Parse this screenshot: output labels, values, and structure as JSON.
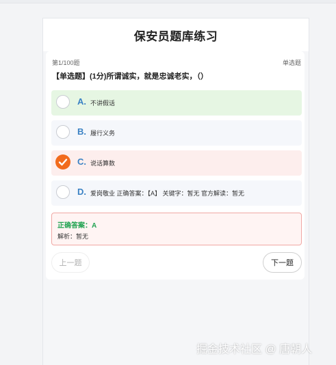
{
  "header": {
    "title": "保安员题库练习"
  },
  "question": {
    "progress": "第1/100题",
    "type_label": "单选题",
    "text": "【单选题】(1分)所谓诚实，就是忠诚老实，（）"
  },
  "options": [
    {
      "letter": "A.",
      "text": "不讲假话",
      "state": "correct"
    },
    {
      "letter": "B.",
      "text": "履行义务",
      "state": "normal"
    },
    {
      "letter": "C.",
      "text": "说话算数",
      "state": "selected-wrong"
    },
    {
      "letter": "D.",
      "text": "爱岗敬业 正确答案：【A】 关键字：暂无 官方解读：暂无",
      "state": "normal"
    }
  ],
  "answer": {
    "correct": "正确答案：A",
    "explanation": "解析：暂无"
  },
  "nav": {
    "prev_label": "上一题",
    "next_label": "下一题"
  },
  "watermark": "掘金技术社区 @ 唐朝人",
  "colors": {
    "correct_bg": "#e6f6e3",
    "wrong_bg": "#fdeeed",
    "selected_check": "#f26b1d",
    "letter": "#3b82c4",
    "answer_text": "#22a352"
  },
  "icons": {
    "selected": "check-icon"
  }
}
